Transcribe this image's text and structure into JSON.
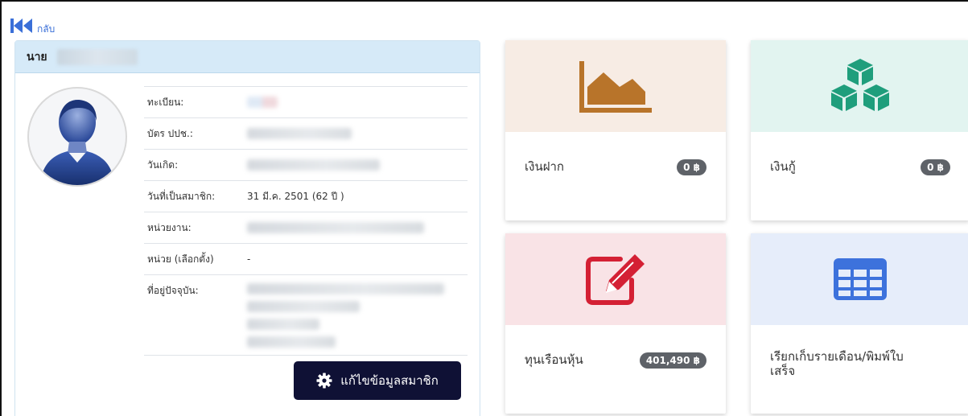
{
  "nav": {
    "back_label": "กลับ"
  },
  "member": {
    "title_prefix": "นาย",
    "edit_button": "แก้ไขข้อมูลสมาชิก",
    "fields": [
      {
        "label": "ทะเบียน:",
        "value": ""
      },
      {
        "label": "บัตร ปปช.:",
        "value": ""
      },
      {
        "label": "วันเกิด:",
        "value": ""
      },
      {
        "label": "วันที่เป็นสมาชิก:",
        "value": "31 มี.ค. 2501 (62 ปี )"
      },
      {
        "label": "หน่วยงาน:",
        "value": ""
      },
      {
        "label": "หน่วย (เลือกตั้ง)",
        "value": "-"
      },
      {
        "label": "ที่อยู่ปัจจุบัน:",
        "value": ""
      }
    ]
  },
  "tiles": [
    {
      "label": "เงินฝาก",
      "badge": "0 ฿",
      "icon": "area-chart-icon",
      "bg": "#f7ece4",
      "color": "#b8742a"
    },
    {
      "label": "เงินกู้",
      "badge": "0 ฿",
      "icon": "cubes-icon",
      "bg": "#e2f4f0",
      "color": "#1f9e7c"
    },
    {
      "label": "ทุนเรือนหุ้น",
      "badge": "401,490 ฿",
      "icon": "edit-icon",
      "bg": "#f9e3e6",
      "color": "#d42034"
    },
    {
      "label": "เรียกเก็บรายเดือน/พิมพ์ใบเสร็จ",
      "badge": "",
      "icon": "table-icon",
      "bg": "#e6edfa",
      "color": "#3d72dc"
    }
  ]
}
